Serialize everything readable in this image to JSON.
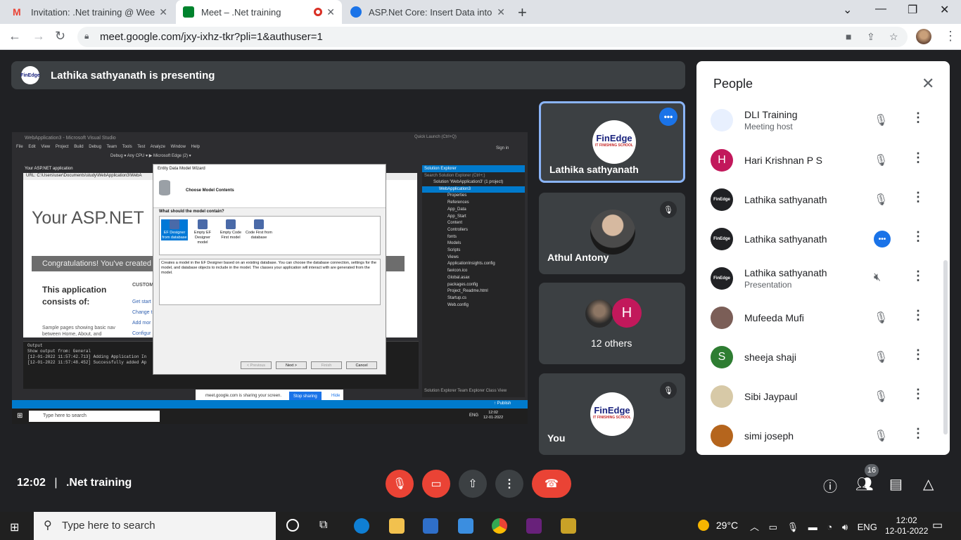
{
  "browser": {
    "tabs": [
      {
        "title": "Invitation: .Net training @ Weekly",
        "favicon_color": "#ea4335"
      },
      {
        "title": "Meet – .Net training",
        "favicon_color": "#00832d"
      },
      {
        "title": "ASP.Net Core: Insert Data into Da",
        "favicon_color": "#1a73e8"
      }
    ],
    "url": "meet.google.com/jxy-ixhz-tkr?pli=1&authuser=1"
  },
  "presenter_banner": "Lathika sathyanath is presenting",
  "shared_screen": {
    "vs_title": "WebApplication3 - Microsoft Visual Studio",
    "vs_menu": "File Edit View Project Build Debug Team Tools Test Analyze Window Help",
    "vs_toolbar": "Debug  ▾   Any CPU  ▾   ▶ Microsoft Edge (2) ▾",
    "quick_launch": "Quick Launch (Ctrl+Q)",
    "sign_in": "Sign in",
    "doc_tab": "Your ASP.NET application",
    "doc_url": "URL:  C:\\Users\\user\\Documents\\study\\WebApplication3\\WebA",
    "hero": "Your ASP.NET",
    "congrats": "Congratulations! You've created a",
    "consists": "This application consists of:",
    "custom": "CUSTOM",
    "links": [
      "Get start",
      "Change t",
      "Add mor",
      "Configur"
    ],
    "sample": "Sample pages showing basic nav between Home, About, and",
    "output_label": "Output",
    "output_from": "Show output from:   General",
    "output_lines": [
      "[12-01-2022 11:57:42.713] Adding Application In",
      "[12-01-2022 11:57:48.452] Successfully added Ap"
    ],
    "solution_explorer": "Solution Explorer",
    "search_solution": "Search Solution Explorer (Ctrl+;)",
    "solution_items": [
      "Solution 'WebApplication3' (1 project)",
      "WebApplication3",
      "Properties",
      "References",
      "App_Data",
      "App_Start",
      "Content",
      "Controllers",
      "fonts",
      "Models",
      "Scripts",
      "Views",
      "ApplicationInsights.config",
      "favicon.ico",
      "Global.asax",
      "packages.config",
      "Project_Readme.html",
      "Startup.cs",
      "Web.config"
    ],
    "sol_tabs": "Solution Explorer   Team Explorer   Class View",
    "publish": "↑ Publish",
    "wizard": {
      "title": "Entity Data Model Wizard",
      "heading": "Choose Model Contents",
      "question": "What should the model contain?",
      "options": [
        "EF Designer from database",
        "Empty EF Designer model",
        "Empty Code First model",
        "Code First from database"
      ],
      "description": "Creates a model in the EF Designer based on an existing database. You can choose the database connection, settings for the model, and database objects to include in the model. The classes your application will interact with are generated from the model.",
      "buttons": [
        "< Previous",
        "Next >",
        "Finish",
        "Cancel"
      ]
    },
    "share_bar": {
      "text": "meet.google.com is sharing your screen.",
      "stop": "Stop sharing",
      "hide": "Hide"
    },
    "win_search": "Type here to search",
    "win_tray": "ENG",
    "win_time": "12:02",
    "win_date": "12-01-2022"
  },
  "tiles": [
    {
      "name": "Lathika sathyanath"
    },
    {
      "name": "Athul Antony"
    },
    {
      "name": "12 others",
      "avatar_letter": "H"
    },
    {
      "name": "You"
    }
  ],
  "logo_text": "FinEdge",
  "logo_sub": "IT FINISHING SCHOOL",
  "people": {
    "title": "People",
    "rows": [
      {
        "name": "DLI Training",
        "sub": "Meeting host",
        "avatar": "",
        "color": "#e8f0fe"
      },
      {
        "name": "Hari Krishnan P S",
        "sub": "",
        "avatar": "H",
        "color": "#c2185b"
      },
      {
        "name": "Lathika sathyanath",
        "sub": "",
        "avatar": "",
        "color": "#202124"
      },
      {
        "name": "Lathika sathyanath",
        "sub": "",
        "avatar": "",
        "color": "#202124"
      },
      {
        "name": "Lathika sathyanath",
        "sub": "Presentation",
        "avatar": "",
        "color": "#202124"
      },
      {
        "name": "Mufeeda Mufi",
        "sub": "",
        "avatar": "",
        "color": "#7b5e57"
      },
      {
        "name": "sheeja shaji",
        "sub": "",
        "avatar": "S",
        "color": "#2e7d32"
      },
      {
        "name": "Sibi Jaypaul",
        "sub": "",
        "avatar": "",
        "color": "#d7c9a7"
      },
      {
        "name": "simi joseph",
        "sub": "",
        "avatar": "",
        "color": "#b5651d"
      }
    ]
  },
  "meeting": {
    "time": "12:02",
    "separator": "|",
    "name": ".Net training",
    "participants_count": "16"
  },
  "taskbar": {
    "search": "Type here to search",
    "weather": "29°C",
    "lang": "ENG",
    "time": "12:02",
    "date": "12-01-2022"
  }
}
